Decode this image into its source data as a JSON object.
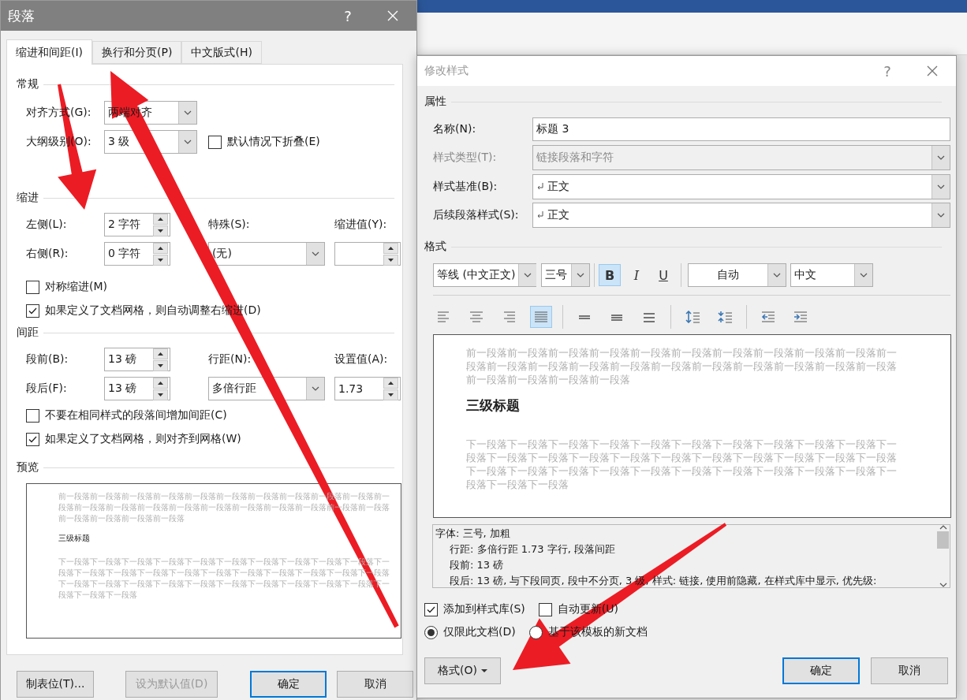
{
  "paragraph_dialog": {
    "title": "段落",
    "help": "?",
    "tabs": [
      {
        "label": "缩进和间距(I)",
        "selected": true
      },
      {
        "label": "换行和分页(P)",
        "selected": false
      },
      {
        "label": "中文版式(H)",
        "selected": false
      }
    ],
    "general": {
      "heading": "常规",
      "alignment": {
        "label": "对齐方式(G):",
        "value": "两端对齐"
      },
      "outline_level": {
        "label": "大纲级别(O):",
        "value": "3 级"
      },
      "collapse": {
        "label": "默认情况下折叠(E)",
        "checked": false
      }
    },
    "indent": {
      "heading": "缩进",
      "left": {
        "label": "左侧(L):",
        "value": "2 字符"
      },
      "right": {
        "label": "右侧(R):",
        "value": "0 字符"
      },
      "special": {
        "label": "特殊(S):",
        "value": "(无)"
      },
      "indent_by": {
        "label": "缩进值(Y):"
      },
      "mirror": {
        "label": "对称缩进(M)",
        "checked": false
      },
      "auto_adjust": {
        "label": "如果定义了文档网格，则自动调整右缩进(D)",
        "checked": true
      }
    },
    "spacing": {
      "heading": "间距",
      "before": {
        "label": "段前(B):",
        "value": "13 磅"
      },
      "after": {
        "label": "段后(F):",
        "value": "13 磅"
      },
      "line_spacing": {
        "label": "行距(N):",
        "value": "多倍行距"
      },
      "at": {
        "label": "设置值(A):",
        "value": "1.73"
      },
      "no_extra": {
        "label": "不要在相同样式的段落间增加间距(C)",
        "checked": false
      },
      "snap": {
        "label": "如果定义了文档网格，则对齐到网格(W)",
        "checked": true
      }
    },
    "preview": {
      "heading": "预览",
      "before_text": "前一段落前一段落前一段落前一段落前一段落前一段落前一段落前一段落前一段落前一段落前一段落前一段落前一段落前一段落前一段落前一段落前一段落前一段落前一段落前一段落前一段落前一段落前一段落前一段落前一段落",
      "title": "三级标题",
      "after_text": "下一段落下一段落下一段落下一段落下一段落下一段落下一段落下一段落下一段落下一段落下一段落下一段落下一段落下一段落下一段落下一段落下一段落下一段落下一段落下一段落下一段落下一段落下一段落下一段落下一段落下一段落下一段落下一段落下一段落下一段落下一段落下一段落下一段落下一段落"
    },
    "buttons": [
      {
        "label": "制表位(T)...",
        "disabled": false,
        "default": false
      },
      {
        "label": "设为默认值(D)",
        "disabled": true,
        "default": false
      },
      {
        "label": "确定",
        "disabled": false,
        "default": true
      },
      {
        "label": "取消",
        "disabled": false,
        "default": false
      }
    ]
  },
  "style_dialog": {
    "title": "修改样式",
    "help": "?",
    "properties": {
      "heading": "属性",
      "fields": [
        {
          "kind": "text",
          "label": "名称(N):",
          "value": "标题 3",
          "disabled": false
        },
        {
          "kind": "dropdown",
          "label": "样式类型(T):",
          "value": "链接段落和字符",
          "disabled": true
        },
        {
          "kind": "style-dropdown",
          "label": "样式基准(B):",
          "value": "正文",
          "disabled": false
        },
        {
          "kind": "style-dropdown",
          "label": "后续段落样式(S):",
          "value": "正文",
          "disabled": false
        }
      ]
    },
    "format": {
      "heading": "格式",
      "font": "等线 (中文正文)",
      "size": "三号",
      "styles": [
        {
          "kind": "bold",
          "label": "B",
          "on": true
        },
        {
          "kind": "italic",
          "label": "I",
          "on": false
        },
        {
          "kind": "underline",
          "label": "U",
          "on": false
        }
      ],
      "color_setting": "自动",
      "script": "中文"
    },
    "paragraph_toolbar": [
      {
        "buttons": [
          {
            "kind": "align-left",
            "selected": false
          },
          {
            "kind": "align-center",
            "selected": false
          },
          {
            "kind": "align-right",
            "selected": false
          },
          {
            "kind": "justify",
            "selected": true
          }
        ]
      },
      {
        "buttons": [
          {
            "kind": "line-single",
            "selected": false
          },
          {
            "kind": "line-onehalf",
            "selected": false
          },
          {
            "kind": "line-double",
            "selected": false
          }
        ]
      },
      {
        "buttons": [
          {
            "kind": "space-more",
            "selected": false
          },
          {
            "kind": "space-less",
            "selected": false
          }
        ]
      },
      {
        "buttons": [
          {
            "kind": "indent-less",
            "selected": false
          },
          {
            "kind": "indent-more",
            "selected": false
          }
        ]
      }
    ],
    "preview": {
      "before_text": "前一段落前一段落前一段落前一段落前一段落前一段落前一段落前一段落前一段落前一段落前一段落前一段落前一段落前一段落前一段落前一段落前一段落前一段落前一段落前一段落前一段落前一段落前一段落前一段落前一段落",
      "title": "三级标题",
      "after_text": "下一段落下一段落下一段落下一段落下一段落下一段落下一段落下一段落下一段落下一段落下一段落下一段落下一段落下一段落下一段落下一段落下一段落下一段落下一段落下一段落下一段落下一段落下一段落下一段落下一段落下一段落下一段落下一段落下一段落下一段落下一段落下一段落下一段落下一段落"
    },
    "description": [
      "字体: 三号, 加粗",
      "行距: 多倍行距 1.73 字行, 段落间距",
      "段前: 13 磅",
      "段后: 13 磅, 与下段同页, 段中不分页, 3 级, 样式: 链接, 使用前隐藏, 在样式库中显示, 优先级:"
    ],
    "options": [
      {
        "label": "添加到样式库(S)",
        "checked": true
      },
      {
        "label": "自动更新(U)",
        "checked": false
      }
    ],
    "scope": [
      {
        "label": "仅限此文档(D)",
        "selected": true
      },
      {
        "label": "基于该模板的新文档",
        "selected": false
      }
    ],
    "format_button": "格式(O)",
    "buttons": [
      {
        "label": "确定",
        "default": true
      },
      {
        "label": "取消",
        "default": false
      }
    ]
  }
}
